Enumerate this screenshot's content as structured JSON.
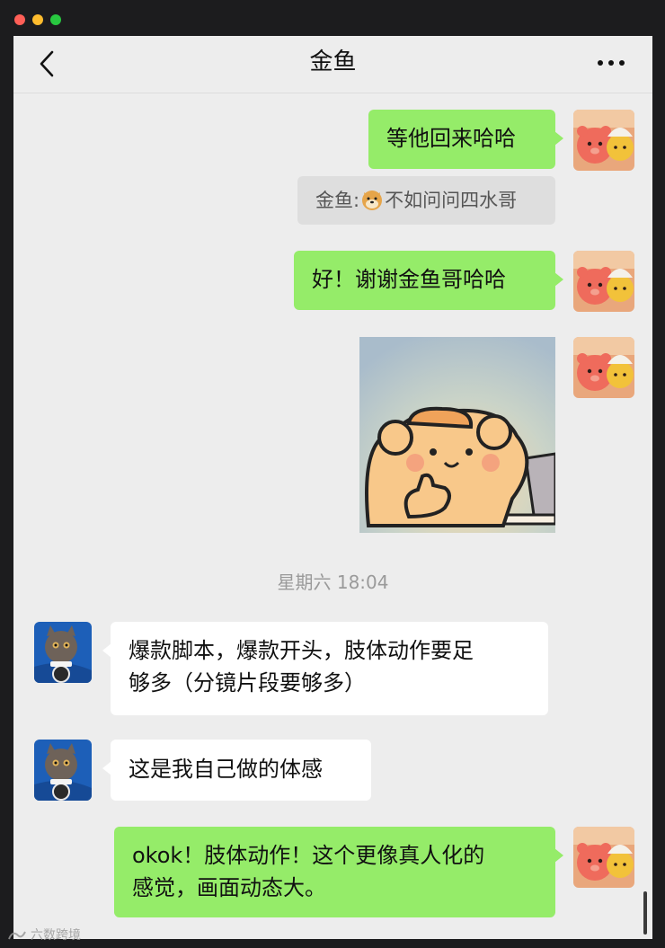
{
  "header": {
    "title": "金鱼"
  },
  "messages": [
    {
      "side": "right",
      "type": "text",
      "text": "等他回来哈哈"
    },
    {
      "side": "center",
      "type": "quote",
      "sender": "金鱼",
      "separator": ":",
      "emoji": "doge-emoji",
      "text": "不如问问四水哥"
    },
    {
      "side": "right",
      "type": "text",
      "text": "好！谢谢金鱼哥哈哈"
    },
    {
      "side": "right",
      "type": "sticker",
      "sticker": "bear-laptop-thumbs-up"
    },
    {
      "side": "left",
      "type": "text",
      "text": "爆款脚本，爆款开头，肢体动作要足够多（分镜片段要够多）",
      "line1": "爆款脚本，爆款开头，肢体动作要足",
      "line2": "够多（分镜片段要够多）"
    },
    {
      "side": "left",
      "type": "text",
      "text": "这是我自己做的体感"
    },
    {
      "side": "right",
      "type": "text",
      "text": "okok！肢体动作！这个更像真人化的感觉，画面动态大。",
      "line1": "okok！肢体动作！这个更像真人化的",
      "line2": "感觉，画面动态大。"
    }
  ],
  "timestamp": "星期六 18:04",
  "watermark": "六数跨境",
  "icons": {
    "back": "chevron-left-icon",
    "more": "more-dots-icon"
  },
  "colors": {
    "window_bg": "#ededed",
    "outgoing_bubble": "#95ec69",
    "incoming_bubble": "#ffffff",
    "quote_bg": "#dedede",
    "timestamp_text": "#9a9a9a"
  }
}
